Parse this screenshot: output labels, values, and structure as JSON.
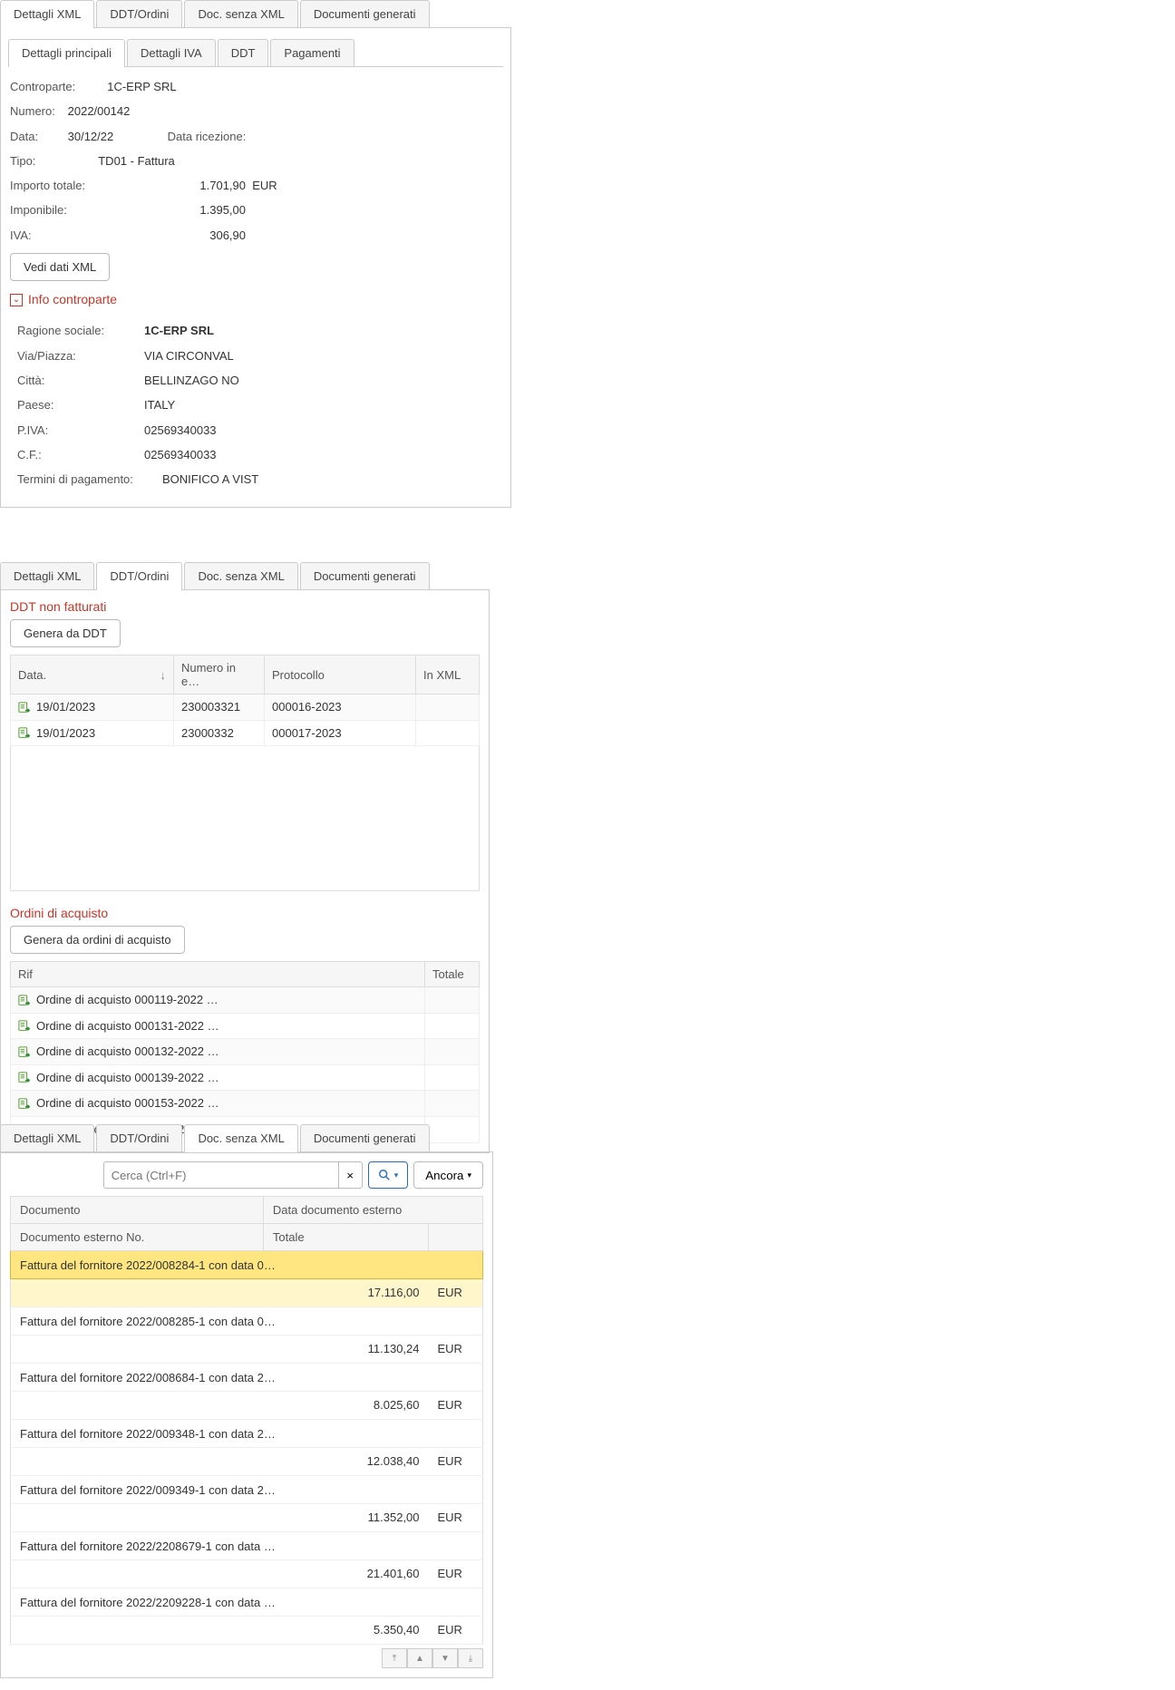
{
  "tabs_main": {
    "t1": "Dettagli XML",
    "t2": "DDT/Ordini",
    "t3": "Doc. senza XML",
    "t4": "Documenti generati"
  },
  "panel1": {
    "inner_tabs": {
      "t1": "Dettagli principali",
      "t2": "Dettagli IVA",
      "t3": "DDT",
      "t4": "Pagamenti"
    },
    "labels": {
      "controparte": "Controparte:",
      "numero": "Numero:",
      "data": "Data:",
      "data_ricezione": "Data ricezione:",
      "tipo": "Tipo:",
      "importo_totale": "Importo totale:",
      "imponibile": "Imponibile:",
      "iva": "IVA:",
      "vedi_xml": "Vedi dati XML",
      "info_controparte": "Info controparte",
      "ragione_sociale": "Ragione sociale:",
      "via": "Via/Piazza:",
      "citta": "Città:",
      "paese": "Paese:",
      "piva": "P.IVA:",
      "cf": "C.F.:",
      "termini": "Termini di pagamento:"
    },
    "values": {
      "controparte": "1C-ERP SRL",
      "numero": "2022/00142",
      "data": "30/12/22",
      "data_ricezione": "",
      "tipo": "TD01 - Fattura",
      "importo_totale": "1.701,90",
      "currency": "EUR",
      "imponibile": "1.395,00",
      "iva": "306,90",
      "ragione_sociale": "1C-ERP SRL",
      "via": "VIA CIRCONVAL",
      "citta": "BELLINZAGO NO",
      "paese": "ITALY",
      "piva": "02569340033",
      "cf": "02569340033",
      "termini": "BONIFICO A VIST"
    }
  },
  "panel2": {
    "section1_title": "DDT non fatturati",
    "btn_genera_ddt": "Genera da DDT",
    "ddt_headers": {
      "data": "Data.",
      "numero": "Numero in e…",
      "protocollo": "Protocollo",
      "in_xml": "In XML"
    },
    "ddt_rows": [
      {
        "data": "19/01/2023",
        "numero": "230003321",
        "protocollo": "000016-2023",
        "in_xml": ""
      },
      {
        "data": "19/01/2023",
        "numero": "23000332",
        "protocollo": "000017-2023",
        "in_xml": ""
      }
    ],
    "section2_title": "Ordini di acquisto",
    "btn_genera_ordini": "Genera da ordini di acquisto",
    "ordini_headers": {
      "rif": "Rif",
      "totale": "Totale"
    },
    "ordini_rows": [
      {
        "rif": "Ordine di acquisto 000119-2022 …"
      },
      {
        "rif": "Ordine di acquisto 000131-2022 …"
      },
      {
        "rif": "Ordine di acquisto 000132-2022 …"
      },
      {
        "rif": "Ordine di acquisto 000139-2022 …"
      },
      {
        "rif": "Ordine di acquisto 000153-2022 …"
      },
      {
        "rif": "Ordine di acquisto 000007-2023 …"
      }
    ]
  },
  "panel3": {
    "search_placeholder": "Cerca (Ctrl+F)",
    "btn_ancora": "Ancora",
    "headers": {
      "documento": "Documento",
      "data_ext": "Data documento esterno",
      "doc_ext_no": "Documento esterno No.",
      "totale": "Totale"
    },
    "rows": [
      {
        "documento": "Fattura del fornitore 2022/008284-1 con data 0…",
        "totale": "17.116,00",
        "cur": "EUR",
        "selected": true
      },
      {
        "documento": "Fattura del fornitore 2022/008285-1 con data 0…",
        "totale": "11.130,24",
        "cur": "EUR"
      },
      {
        "documento": "Fattura del fornitore 2022/008684-1 con data 2…",
        "totale": "8.025,60",
        "cur": "EUR"
      },
      {
        "documento": "Fattura del fornitore 2022/009348-1 con data 2…",
        "totale": "12.038,40",
        "cur": "EUR"
      },
      {
        "documento": "Fattura del fornitore 2022/009349-1 con data 2…",
        "totale": "11.352,00",
        "cur": "EUR"
      },
      {
        "documento": "Fattura del fornitore 2022/2208679-1 con data …",
        "totale": "21.401,60",
        "cur": "EUR"
      },
      {
        "documento": "Fattura del fornitore 2022/2209228-1 con data …",
        "totale": "5.350,40",
        "cur": "EUR"
      }
    ]
  }
}
